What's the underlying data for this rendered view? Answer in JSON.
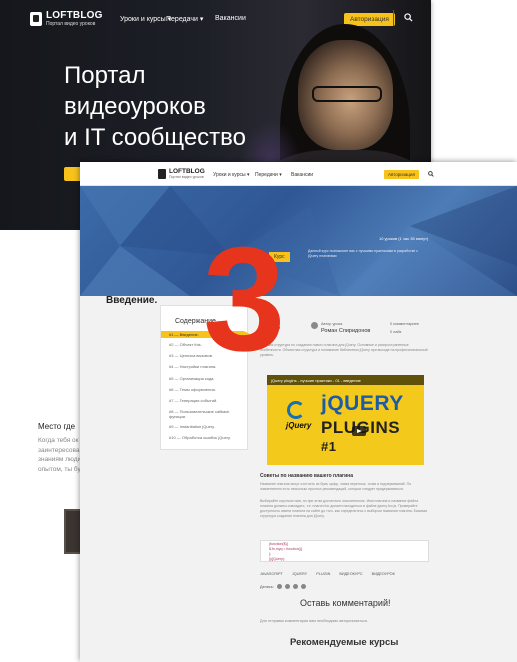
{
  "back_page": {
    "logo": {
      "name": "LOFTBLOG",
      "tagline": "Портал видео уроков"
    },
    "nav": [
      "Уроки и курсы",
      "Передачи",
      "Вакансии"
    ],
    "auth_button": "Авторизация",
    "hero_title_lines": [
      "Портал",
      "видеоуроков",
      "и IT сообщество"
    ],
    "section_title": "Место где",
    "section_text_lines": [
      "Когда тебя ок",
      "заинтересова",
      "знаниям люди",
      "опытом, ты бу"
    ]
  },
  "front_page": {
    "logo": {
      "name": "LOFTBLOG",
      "tagline": "Портал видео уроков"
    },
    "nav": [
      "Уроки и курсы",
      "Передачи",
      "Вакансии"
    ],
    "auth_button": "Авторизация",
    "banner": {
      "course_tag": "Курс",
      "meta": "10 уроков  (1 час 35 минут)",
      "description": "Данный курс познакомит вас с лучшими практиками в разработке с jQuery плагинами"
    },
    "toc": {
      "title": "Содержание",
      "items": [
        "#1 — Введение.",
        "#2 — Объект this.",
        "#3 — Цепочка вызовов.",
        "#4 — Настройки плагина.",
        "#5 — Организация кода.",
        "#6 — Темы оформления.",
        "#7 — Генерация событий.",
        "#8 — Пользовательские callback функции.",
        "#9 — Instantiation jQuery.",
        "#10 — Обработка ошибок jQuery."
      ]
    },
    "article": {
      "title": "Введение.",
      "number": "13",
      "author_role": "Автор урока",
      "author_name": "Роман Спиридонов",
      "stats": [
        "0 комментариев",
        "0 лайк"
      ],
      "intro": "Базовая структура по созданию нового плагина для jQuery. Основные и распространенные особенности. Объектная структура и понимание библиотеки jQuery при выходе на профессиональный уровень.",
      "video_title": "jQuery plugins - лучшие практики - 01 - введение",
      "video_word_small": "jQuery",
      "video_word_big1": "jQUERY",
      "video_word_big2": "PLUGINS",
      "video_suffix": "#1",
      "subheading": "Советы по названию вашего плагина",
      "para1": "Название плагина могут состоять из букв, цифр, знака переноса, точки и подчеркиваний. По знаменателю есть несколько простых рекомендаций, которых следует придерживаться.",
      "para2": "Выбирайте короткое имя, но при этом достаточно описательное. Имя плагина и название файла плагина должны совпадать, т.е. плагин foo должен находиться в файле jquery.foo.js. Проверяйте доступность имени плагина на сайте до того, как определитесь с выбором названия плагина. Базовая структура создания плагина для jQuery.",
      "code_lines": [
        "(function($){",
        "  $.fn.myq = function(){",
        "  };",
        "})(jQuery);"
      ],
      "tags": [
        "JAVASCRIPT",
        "JQUERY",
        "PLUGIN",
        "ВИДЕОКУРС",
        "ВИДЕОУРОК"
      ],
      "share_label": "Делись:",
      "comments_heading": "Оставь комментарий!",
      "login_note": "Для отправки комментария вам необходимо авторизоваться.",
      "recommended_heading": "Рекомендуемые курсы"
    }
  },
  "overlay_number": "3",
  "colors": {
    "accent": "#f7c21a",
    "overlay": "#e6351c",
    "banner": "#3c6aa8"
  }
}
